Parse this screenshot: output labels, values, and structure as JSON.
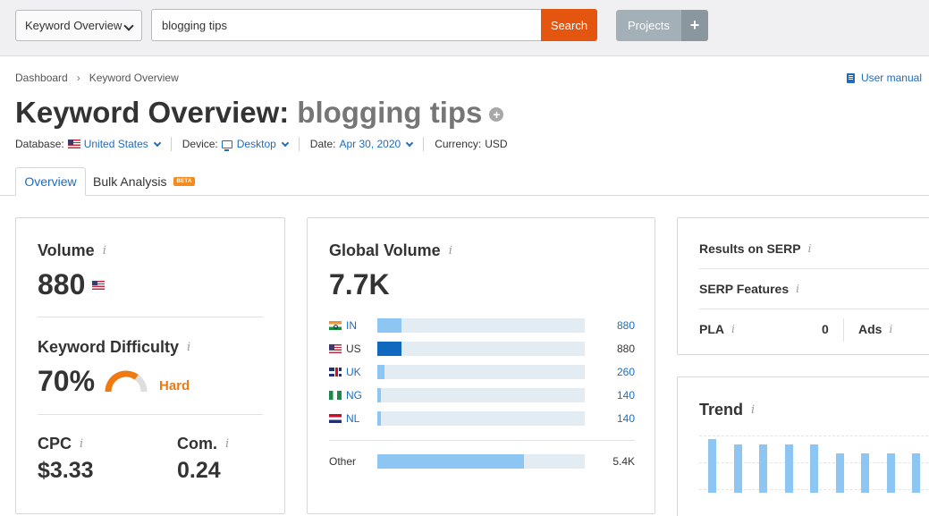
{
  "toolbar": {
    "tool_select": "Keyword Overview",
    "search_value": "blogging tips",
    "search_label": "Search",
    "projects_label": "Projects",
    "projects_add": "+"
  },
  "breadcrumb": {
    "items": [
      "Dashboard",
      "Keyword Overview"
    ],
    "separator": "›"
  },
  "user_manual": "User manual",
  "header": {
    "title_prefix": "Keyword Overview:",
    "keyword": "blogging tips",
    "add_icon": "+"
  },
  "meta": {
    "database_label": "Database:",
    "database_value": "United States",
    "device_label": "Device:",
    "device_value": "Desktop",
    "date_label": "Date:",
    "date_value": "Apr 30, 2020",
    "currency_label": "Currency:",
    "currency_value": "USD"
  },
  "tabs": {
    "overview": "Overview",
    "bulk": "Bulk Analysis",
    "beta": "BETA"
  },
  "info_glyph": "i",
  "volume": {
    "title": "Volume",
    "value": "880"
  },
  "difficulty": {
    "title": "Keyword Difficulty",
    "value": "70%",
    "level": "Hard",
    "percent": 70
  },
  "cpc": {
    "title": "CPC",
    "value": "$3.33"
  },
  "competition": {
    "title": "Com.",
    "value": "0.24"
  },
  "global_volume": {
    "title": "Global Volume",
    "value": "7.7K",
    "rows": [
      {
        "code": "IN",
        "value": "880",
        "fill": 0.115,
        "style": "light",
        "link": true
      },
      {
        "code": "US",
        "value": "880",
        "fill": 0.115,
        "style": "dark",
        "link": false
      },
      {
        "code": "UK",
        "value": "260",
        "fill": 0.036,
        "style": "light",
        "link": true
      },
      {
        "code": "NG",
        "value": "140",
        "fill": 0.018,
        "style": "light",
        "link": true
      },
      {
        "code": "NL",
        "value": "140",
        "fill": 0.018,
        "style": "light",
        "link": true
      }
    ],
    "other": {
      "label": "Other",
      "value": "5.4K",
      "fill": 0.705
    }
  },
  "serp": {
    "results_label": "Results on SERP",
    "features_label": "SERP Features",
    "pla_label": "PLA",
    "pla_value": "0",
    "ads_label": "Ads"
  },
  "trend": {
    "title": "Trend",
    "values": [
      1.0,
      0.9,
      0.9,
      0.9,
      0.9,
      0.74,
      0.74,
      0.74,
      0.74
    ]
  },
  "colors": {
    "accent": "#1e6cbd",
    "search_button": "#e4550f",
    "hard": "#f07a12",
    "bar_light": "#8dc6f2",
    "bar_dark": "#1068bf"
  }
}
